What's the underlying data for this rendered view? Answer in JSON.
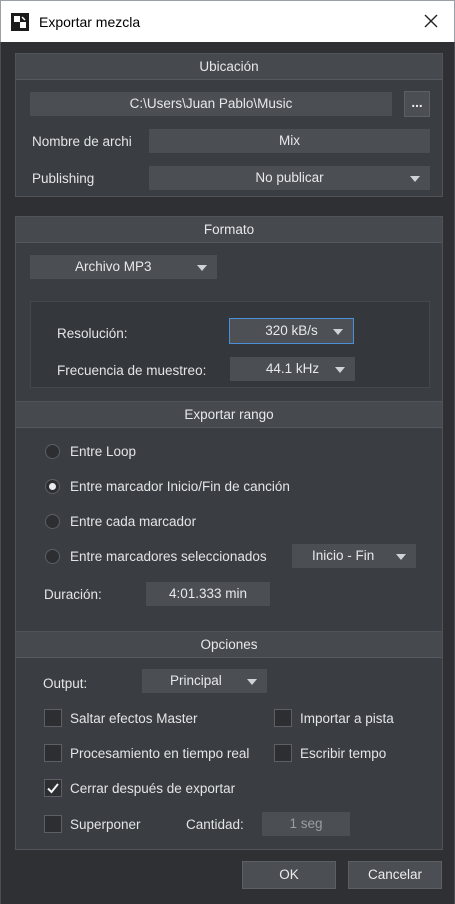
{
  "window": {
    "title": "Exportar mezcla",
    "icon": "app-logo-icon",
    "close_icon": "close-icon"
  },
  "ubicacion": {
    "header": "Ubicación",
    "path": "C:\\Users\\Juan Pablo\\Music",
    "browse_label": "...",
    "filename_label": "Nombre de archi",
    "filename_value": "Mix",
    "publishing_label": "Publishing",
    "publishing_value": "No publicar"
  },
  "formato": {
    "header": "Formato",
    "format_value": "Archivo MP3",
    "resolution_label": "Resolución:",
    "resolution_value": "320 kB/s",
    "samplerate_label": "Frecuencia de muestreo:",
    "samplerate_value": "44.1 kHz"
  },
  "rango": {
    "header": "Exportar rango",
    "options": [
      {
        "label": "Entre Loop",
        "selected": false
      },
      {
        "label": "Entre marcador Inicio/Fin de canción",
        "selected": true
      },
      {
        "label": "Entre cada marcador",
        "selected": false
      },
      {
        "label": "Entre marcadores seleccionados",
        "selected": false
      }
    ],
    "marker_select_value": "Inicio - Fin",
    "duration_label": "Duración:",
    "duration_value": "4:01.333 min"
  },
  "opciones": {
    "header": "Opciones",
    "output_label": "Output:",
    "output_value": "Principal",
    "checkboxes": [
      {
        "label": "Saltar efectos Master",
        "checked": false
      },
      {
        "label": "Importar a pista",
        "checked": false
      },
      {
        "label": "Procesamiento en tiempo real",
        "checked": false
      },
      {
        "label": "Escribir tempo",
        "checked": false
      },
      {
        "label": "Cerrar después de exportar",
        "checked": true
      },
      {
        "label": "Superponer",
        "checked": false
      }
    ],
    "amount_label": "Cantidad:",
    "amount_value": "1 seg"
  },
  "buttons": {
    "ok": "OK",
    "cancel": "Cancelar"
  },
  "colors": {
    "background": "#2e3033",
    "panel": "#3a3d41",
    "field": "#4b4e53",
    "highlight_border": "#4a90d9"
  }
}
